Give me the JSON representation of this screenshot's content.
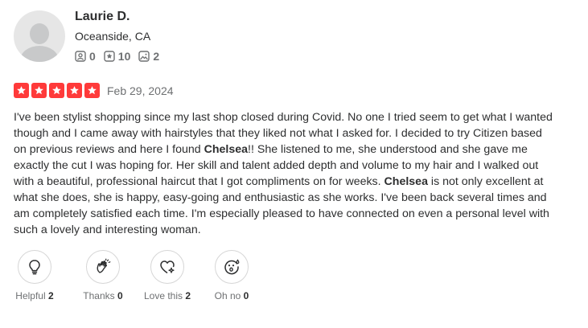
{
  "reviewer": {
    "name": "Laurie D.",
    "location": "Oceanside, CA",
    "stats": {
      "friends": "0",
      "reviews": "10",
      "photos": "2"
    }
  },
  "review": {
    "rating": 5,
    "rating_color": "#ff3a3a",
    "date": "Feb 29, 2024",
    "text_parts": [
      "I've been stylist shopping since my last shop closed during Covid. No one I tried seem to get what I wanted though and I came away with hairstyles that they liked not what I asked for. I decided to try Citizen based on previous reviews and here I found ",
      "Chelsea",
      "!! She listened to me, she understood and she gave me exactly the cut I was hoping for. Her skill and talent added depth and volume to my hair and I walked out with a beautiful, professional haircut that I got compliments on for weeks. ",
      "Chelsea",
      " is not only excellent at what she does, she is happy, easy-going and enthusiastic as she works. I've been back several times and am completely satisfied each time. I'm especially pleased to have connected on even a personal level with such a lovely and interesting woman."
    ]
  },
  "reactions": [
    {
      "label": "Helpful",
      "count": "2",
      "icon": "lightbulb-icon"
    },
    {
      "label": "Thanks",
      "count": "0",
      "icon": "clapping-hands-icon"
    },
    {
      "label": "Love this",
      "count": "2",
      "icon": "heart-sparkle-icon"
    },
    {
      "label": "Oh no",
      "count": "0",
      "icon": "surprised-face-icon"
    }
  ]
}
